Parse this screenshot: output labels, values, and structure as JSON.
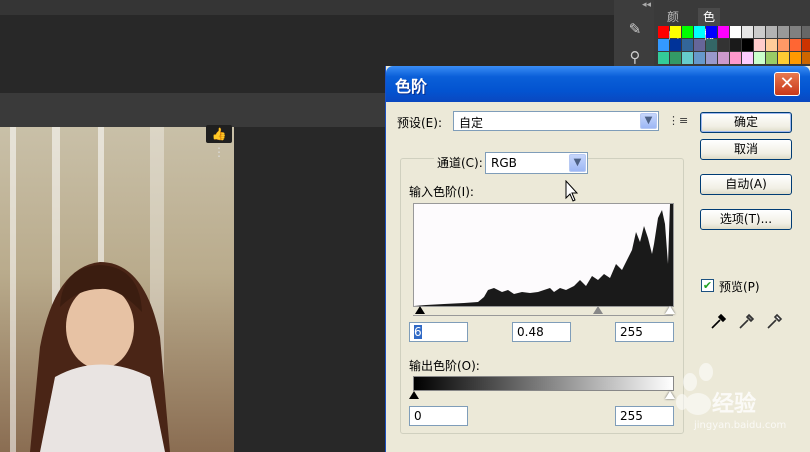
{
  "photoshop": {
    "panel_tabs": [
      "颜色",
      "色板"
    ],
    "active_tab": "色板",
    "swatches": [
      "#ff0000",
      "#ffff00",
      "#00ff00",
      "#00ffff",
      "#0000ff",
      "#ff00ff",
      "#ffffff",
      "#e6e6e6",
      "#cccccc",
      "#b3b3b3",
      "#999999",
      "#808080",
      "#666666",
      "#3399ff",
      "#003399",
      "#336699",
      "#666699",
      "#336666",
      "#333333",
      "#1a1a1a",
      "#000000",
      "#ffcccc",
      "#ffcc99",
      "#ff9966",
      "#ff6633",
      "#cc3300",
      "#33cc99",
      "#339966",
      "#66cccc",
      "#6699cc",
      "#9999cc",
      "#cc99cc",
      "#ff99cc",
      "#ffccff",
      "#ccffcc",
      "#99cc66",
      "#ffcc33",
      "#ff9900",
      "#cc6600"
    ],
    "photo_badge": "👍 ⋮"
  },
  "dialog": {
    "title": "色阶",
    "close_glyph": "✕",
    "preset_label": "预设(E):",
    "preset_value": "自定",
    "preset_menu_glyph": "⋮≡",
    "channel_label": "通道(C):",
    "channel_value": "RGB",
    "input_levels_label": "输入色阶(I):",
    "input_black": "6",
    "input_gamma": "0.48",
    "input_white": "255",
    "output_levels_label": "输出色阶(O):",
    "output_black": "0",
    "output_white": "255",
    "buttons": {
      "ok": "确定",
      "cancel": "取消",
      "auto": "自动(A)",
      "options": "选项(T)..."
    },
    "preview_label": "预览(P)",
    "preview_checked": true
  },
  "watermark": {
    "text": "经验",
    "url": "jingyan.baidu.com"
  }
}
